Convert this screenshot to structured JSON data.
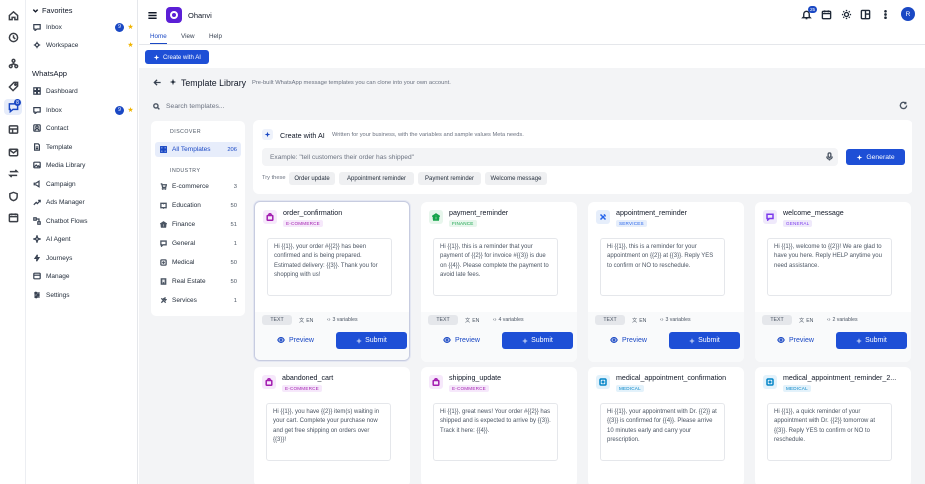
{
  "header": {
    "app_name": "Ohanvi",
    "notif_count": "25",
    "avatar": "R"
  },
  "tabs": [
    "Home",
    "View",
    "Help"
  ],
  "ribbon": {
    "create_ai_label": "Create with AI"
  },
  "sidebar": {
    "favorites_title": "Favorites",
    "favorites": [
      {
        "label": "Inbox",
        "count": "9",
        "star": "★"
      },
      {
        "label": "Workspace",
        "star": "★"
      }
    ],
    "section_title": "WhatsApp",
    "items": [
      {
        "label": "Dashboard"
      },
      {
        "label": "Inbox",
        "count": "9",
        "star": "★"
      },
      {
        "label": "Contact"
      },
      {
        "label": "Template"
      },
      {
        "label": "Media Library"
      },
      {
        "label": "Campaign"
      },
      {
        "label": "Ads Manager"
      },
      {
        "label": "Chatbot Flows"
      },
      {
        "label": "AI Agent"
      },
      {
        "label": "Journeys"
      },
      {
        "label": "Manage"
      },
      {
        "label": "Settings"
      }
    ]
  },
  "rail": {
    "badge": "8"
  },
  "library": {
    "title": "Template Library",
    "subtitle": "Pre-built WhatsApp message templates you can clone into your own account.",
    "search_placeholder": "Search templates..."
  },
  "filters": {
    "discover_title": "DISCOVER",
    "all": {
      "label": "All Templates",
      "count": "206"
    },
    "industry_title": "INDUSTRY",
    "items": [
      {
        "label": "E-commerce",
        "count": "3"
      },
      {
        "label": "Education",
        "count": "50"
      },
      {
        "label": "Finance",
        "count": "51"
      },
      {
        "label": "General",
        "count": "1"
      },
      {
        "label": "Medical",
        "count": "50"
      },
      {
        "label": "Real Estate",
        "count": "50"
      },
      {
        "label": "Services",
        "count": "1"
      }
    ]
  },
  "ai_panel": {
    "title": "Create with AI",
    "subtitle": "Written for your business, with the variables and sample values Meta needs.",
    "placeholder": "Example: \"tell customers their order has shipped\"",
    "generate_label": "Generate",
    "try_label": "Try these",
    "chips": [
      "Order update",
      "Appointment reminder",
      "Payment reminder",
      "Welcome message"
    ]
  },
  "card_labels": {
    "preview": "Preview",
    "submit": "Submit"
  },
  "cards": [
    {
      "name": "order_confirmation",
      "category": "E-COMMERCE",
      "body": "Hi {{1}}, your order #{{2}} has been confirmed and is being prepared. Estimated delivery: {{3}}. Thank you for shopping with us!",
      "type": "TEXT",
      "lang": "EN",
      "vars": "3 variables"
    },
    {
      "name": "payment_reminder",
      "category": "FINANCE",
      "body": "Hi {{1}}, this is a reminder that your payment of {{2}} for invoice #{{3}} is due on {{4}}. Please complete the payment to avoid late fees.",
      "type": "TEXT",
      "lang": "EN",
      "vars": "4 variables"
    },
    {
      "name": "appointment_reminder",
      "category": "SERVICES",
      "body": "Hi {{1}}, this is a reminder for your appointment on {{2}} at {{3}}. Reply YES to confirm or NO to reschedule.",
      "type": "TEXT",
      "lang": "EN",
      "vars": "3 variables"
    },
    {
      "name": "welcome_message",
      "category": "GENERAL",
      "body": "Hi {{1}}, welcome to {{2}}! We are glad to have you here. Reply HELP anytime you need assistance.",
      "type": "TEXT",
      "lang": "EN",
      "vars": "2 variables"
    },
    {
      "name": "abandoned_cart",
      "category": "E-COMMERCE",
      "body": "Hi {{1}}, you have {{2}} item(s) waiting in your cart. Complete your purchase now and get free shipping on orders over {{3}}!"
    },
    {
      "name": "shipping_update",
      "category": "E-COMMERCE",
      "body": "Hi {{1}}, great news! Your order #{{2}} has shipped and is expected to arrive by {{3}}. Track it here: {{4}}."
    },
    {
      "name": "medical_appointment_confirmation",
      "category": "MEDICAL",
      "body": "Hi {{1}}, your appointment with Dr. {{2}} at {{3}} is confirmed for {{4}}. Please arrive 10 minutes early and carry your prescription."
    },
    {
      "name": "medical_appointment_reminder_2...",
      "category": "MEDICAL",
      "body": "Hi {{1}}, a quick reminder of your appointment with Dr. {{2}} tomorrow at {{3}}. Reply YES to confirm or NO to reschedule."
    }
  ],
  "colors": {
    "accent": "#1e4fd6",
    "ecommerce": "#a21caf",
    "finance": "#16a34a",
    "services": "#2563eb",
    "general": "#7c3aed",
    "medical": "#0284c7"
  }
}
